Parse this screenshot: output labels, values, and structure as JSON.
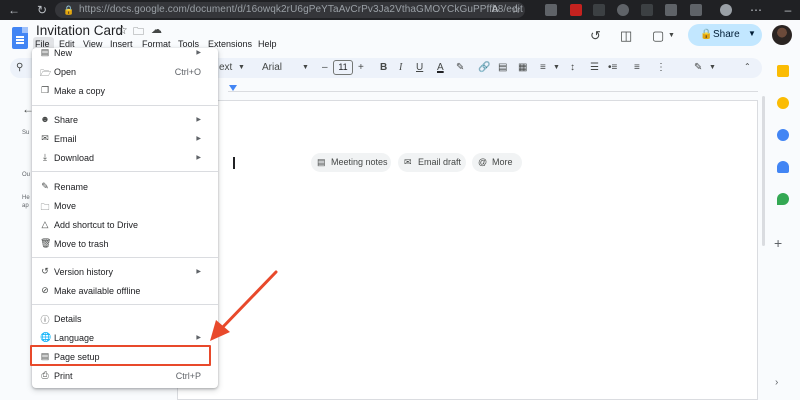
{
  "browser": {
    "url": "https://docs.google.com/document/d/16owqk2rU6gPeYTaAvCrPv3Ja2VthaGMOYCkGuPPffb8/edit",
    "icons": [
      "back-icon",
      "refresh-icon",
      "lock-icon",
      "extension-icons",
      "minimize-icon"
    ]
  },
  "doc": {
    "title": "Invitation Card"
  },
  "menubar": {
    "items": [
      "File",
      "Edit",
      "View",
      "Insert",
      "Format",
      "Tools",
      "Extensions",
      "Help"
    ]
  },
  "header": {
    "share_label": "Share"
  },
  "toolbar": {
    "style_label": "ext",
    "font": "Arial",
    "font_size": "11"
  },
  "left_panel": {
    "texts": [
      "Su",
      "Ou",
      "He",
      "ap"
    ]
  },
  "chips": [
    {
      "label": "Meeting notes",
      "icon": "document-icon"
    },
    {
      "label": "Email draft",
      "icon": "email-icon"
    },
    {
      "label": "More",
      "icon": "at-icon"
    }
  ],
  "file_menu": {
    "items": [
      {
        "label": "New",
        "icon": "new-document-icon",
        "submenu": true
      },
      {
        "label": "Open",
        "icon": "folder-open-icon",
        "shortcut": "Ctrl+O"
      },
      {
        "label": "Make a copy",
        "icon": "copy-icon"
      },
      {
        "label": "Share",
        "icon": "person-add-icon",
        "submenu": true
      },
      {
        "label": "Email",
        "icon": "email-icon",
        "submenu": true
      },
      {
        "label": "Download",
        "icon": "download-icon",
        "submenu": true
      },
      {
        "label": "Rename",
        "icon": "rename-icon"
      },
      {
        "label": "Move",
        "icon": "move-folder-icon"
      },
      {
        "label": "Add shortcut to Drive",
        "icon": "drive-shortcut-icon"
      },
      {
        "label": "Move to trash",
        "icon": "trash-icon"
      },
      {
        "label": "Version history",
        "icon": "history-icon",
        "submenu": true
      },
      {
        "label": "Make available offline",
        "icon": "offline-icon"
      },
      {
        "label": "Details",
        "icon": "info-icon"
      },
      {
        "label": "Language",
        "icon": "globe-icon",
        "submenu": true
      },
      {
        "label": "Page setup",
        "icon": "page-icon"
      },
      {
        "label": "Print",
        "icon": "print-icon",
        "shortcut": "Ctrl+P"
      }
    ]
  },
  "colors": {
    "accent": "#e8492b",
    "share_bg": "#c2e7ff",
    "docs_blue": "#4285f4"
  }
}
